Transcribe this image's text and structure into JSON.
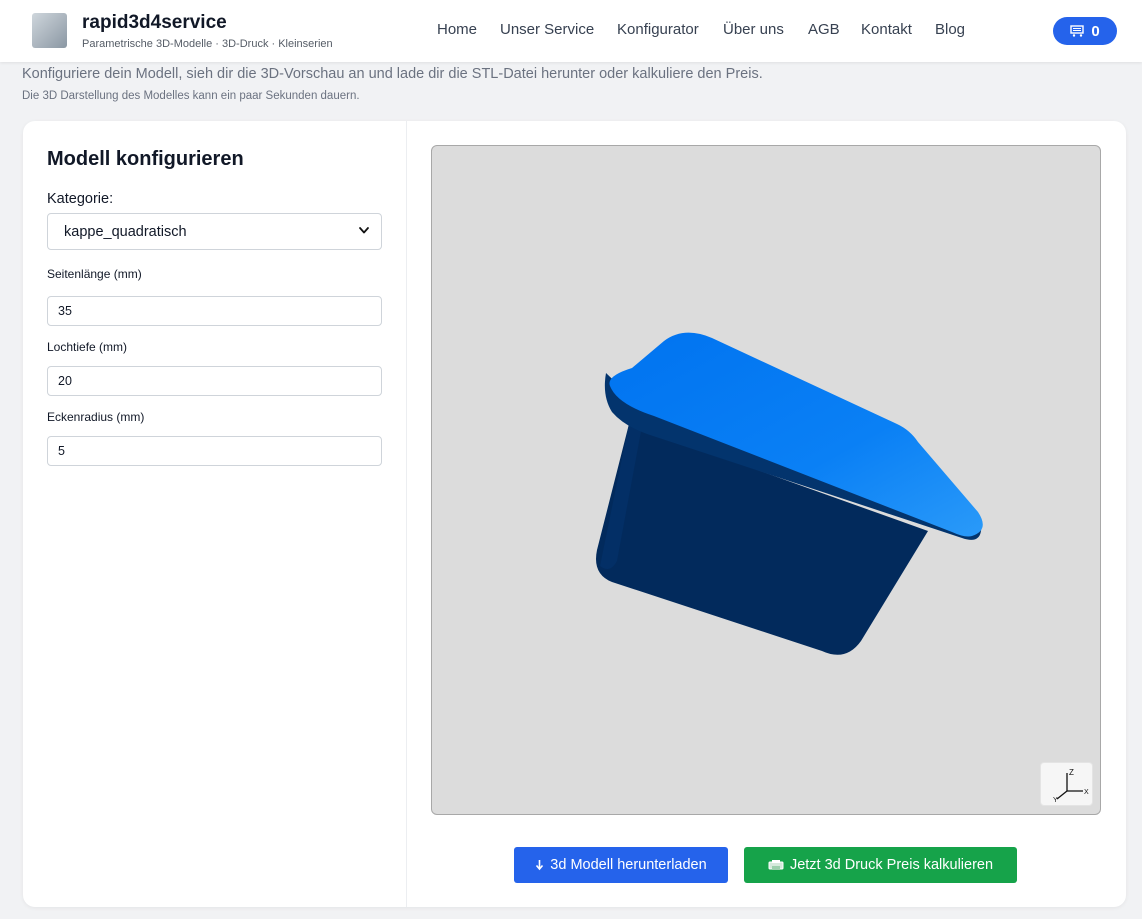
{
  "header": {
    "brand_title": "rapid3d4service",
    "brand_subtitle": "Parametrische 3D-Modelle · 3D-Druck · Kleinserien",
    "nav": [
      "Home",
      "Unser Service",
      "Konfigurator",
      "Über uns",
      "AGB",
      "Kontakt",
      "Blog"
    ],
    "cart_count": "0",
    "cart_icon": "cart-icon"
  },
  "intro": {
    "line1": "Konfiguriere dein Modell, sieh dir die 3D-Vorschau an und lade dir die STL-Datei herunter oder kalkuliere den Preis.",
    "line2": "Die 3D Darstellung des Modelles kann ein paar Sekunden dauern."
  },
  "form": {
    "title": "Modell konfigurieren",
    "category_label": "Kategorie:",
    "category_value": "kappe_quadratisch",
    "fields": [
      {
        "label": "Seitenlänge (mm)",
        "value": "35"
      },
      {
        "label": "Lochtiefe (mm)",
        "value": "20"
      },
      {
        "label": "Eckenradius (mm)",
        "value": "5"
      }
    ]
  },
  "viewer": {
    "axis_labels": {
      "z": "Z",
      "y": "Y",
      "x": "X"
    }
  },
  "actions": {
    "download_label": "3d Modell herunterladen",
    "download_icon": "download-icon",
    "price_label": "Jetzt 3d Druck Preis kalkulieren",
    "price_icon": "printer-icon"
  },
  "colors": {
    "primary": "#2563eb",
    "success": "#16a34a",
    "model_top": "#0a7ff5",
    "model_body": "#022a5c"
  }
}
